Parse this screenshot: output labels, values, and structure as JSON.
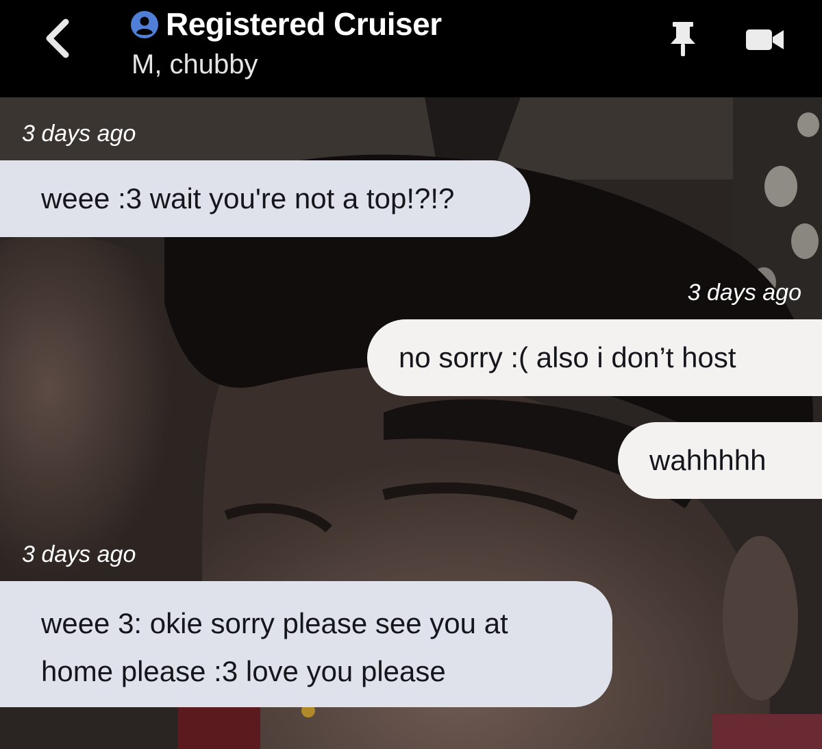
{
  "header": {
    "back_icon": "chevron-left-icon",
    "profile_icon": "user-circle-icon",
    "title": "Registered Cruiser",
    "subtitle": "M, chubby",
    "pin_icon": "pin-icon",
    "video_icon": "video-camera-icon"
  },
  "colors": {
    "header_bg": "#000000",
    "profile_icon": "#4f7fd6",
    "received_bubble": "#dfe2ea",
    "sent_bubble": "#f3f2f0",
    "bubble_text": "#15151c",
    "timestamp_text": "#ffffff"
  },
  "messages": [
    {
      "timestamp": "3 days ago",
      "direction": "received",
      "text": "weee :3 wait you're not a top!?!?"
    },
    {
      "timestamp": "3 days ago",
      "direction": "sent",
      "text": "no sorry :( also i don’t host"
    },
    {
      "direction": "sent",
      "text": "wahhhhh"
    },
    {
      "timestamp": "3 days ago",
      "direction": "received",
      "lines": [
        "weee 3: okie sorry please see you at",
        "home please :3 love you please"
      ]
    }
  ]
}
